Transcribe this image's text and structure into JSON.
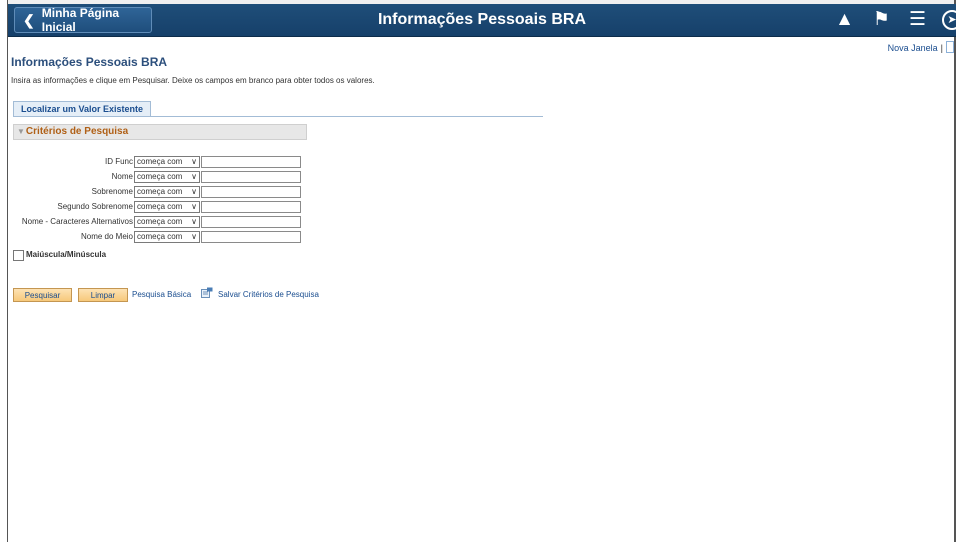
{
  "header": {
    "back_label": "Minha Página Inicial",
    "title": "Informações Pessoais BRA",
    "icons": [
      "home-icon",
      "flag-icon",
      "menu-icon",
      "navbar-icon"
    ]
  },
  "top_links": {
    "new_window": "Nova Janela",
    "separator": "|"
  },
  "page": {
    "title": "Informações Pessoais BRA",
    "instructions": "Insira as informações e clique em Pesquisar. Deixe os campos em branco para obter todos os valores."
  },
  "tabs": [
    {
      "label": "Localizar um Valor Existente"
    }
  ],
  "criteria": {
    "header": "Critérios de Pesquisa",
    "fields": [
      {
        "label": "ID Func",
        "operator": "começa com",
        "value": ""
      },
      {
        "label": "Nome",
        "operator": "começa com",
        "value": ""
      },
      {
        "label": "Sobrenome",
        "operator": "começa com",
        "value": ""
      },
      {
        "label": "Segundo Sobrenome",
        "operator": "começa com",
        "value": ""
      },
      {
        "label": "Nome - Caracteres Alternativos",
        "operator": "começa com",
        "value": ""
      },
      {
        "label": "Nome do Meio",
        "operator": "começa com",
        "value": ""
      }
    ],
    "case_sensitive_label": "Maiúscula/Minúscula",
    "case_sensitive_checked": false
  },
  "actions": {
    "search": "Pesquisar",
    "clear": "Limpar",
    "basic_search": "Pesquisa Básica",
    "save_criteria": "Salvar Critérios de Pesquisa"
  },
  "colors": {
    "banner": "#1f4e79",
    "link": "#1a4d8f",
    "section_title": "#b06016",
    "button": "#f7c97b"
  }
}
